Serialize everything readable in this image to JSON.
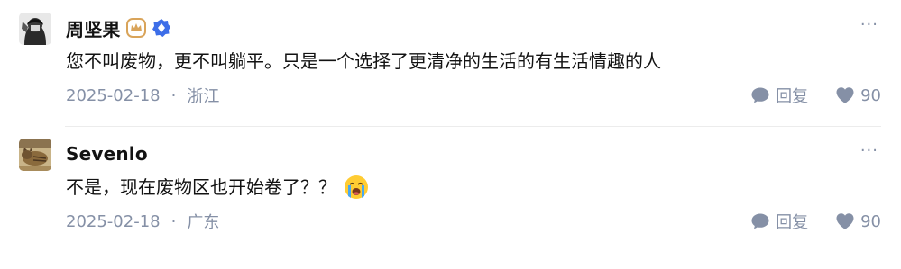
{
  "comments": [
    {
      "author": "周坚果",
      "author_badges": [
        "crown-badge-icon",
        "verified-badge-icon"
      ],
      "text": "您不叫废物，更不叫躺平。只是一个选择了更清净的生活的有生活情趣的人",
      "date": "2025-02-18",
      "separator": "·",
      "location": "浙江",
      "reply_label": "回复",
      "likes": "90",
      "more_label": "···"
    },
    {
      "author": "Sevenlo",
      "text": "不是，现在废物区也开始卷了？？",
      "emoji": "crying-face-emoji",
      "date": "2025-02-18",
      "separator": "·",
      "location": "广东",
      "reply_label": "回复",
      "likes": "90",
      "more_label": "···"
    }
  ],
  "colors": {
    "meta": "#8590a6",
    "text": "#121212",
    "badge_gold": "#d9a45a",
    "badge_blue": "#3d6ee8"
  }
}
